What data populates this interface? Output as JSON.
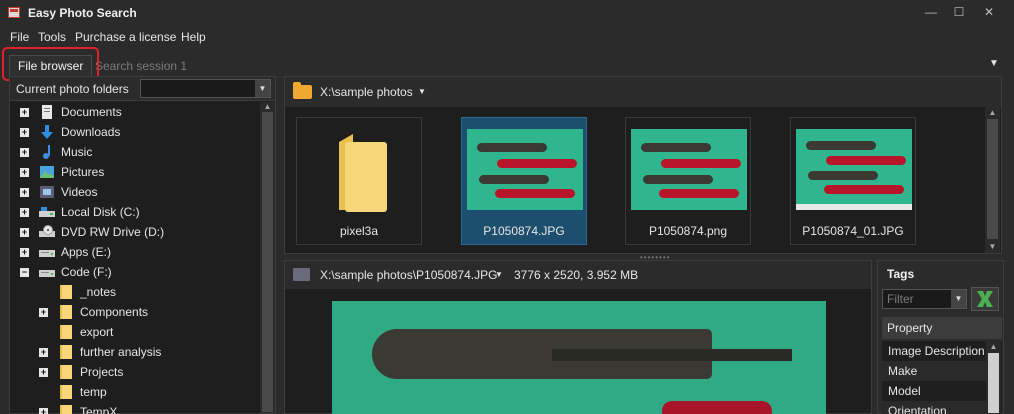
{
  "window": {
    "title": "Easy Photo Search",
    "minimize": "—",
    "maximize": "☐",
    "close": "✕"
  },
  "menu": [
    "File",
    "Tools",
    "Purchase a license",
    "Help"
  ],
  "tabs": {
    "active": "File browser",
    "inactive": "Search session 1",
    "menu_glyph": "▼"
  },
  "left_panel": {
    "header": "Current photo folders",
    "items": [
      {
        "label": "Documents",
        "icon": "documents-icon"
      },
      {
        "label": "Downloads",
        "icon": "downloads-icon"
      },
      {
        "label": "Music",
        "icon": "music-icon"
      },
      {
        "label": "Pictures",
        "icon": "pictures-icon"
      },
      {
        "label": "Videos",
        "icon": "videos-icon"
      },
      {
        "label": "Local Disk (C:)",
        "icon": "drive-icon"
      },
      {
        "label": "DVD RW Drive (D:)",
        "icon": "dvd-drive-icon"
      },
      {
        "label": "Apps (E:)",
        "icon": "drive-icon"
      },
      {
        "label": "Code (F:)",
        "icon": "drive-icon"
      },
      {
        "label": "_notes",
        "icon": "folder-icon"
      },
      {
        "label": "Components",
        "icon": "folder-icon"
      },
      {
        "label": "export",
        "icon": "folder-icon"
      },
      {
        "label": "further analysis",
        "icon": "folder-icon"
      },
      {
        "label": "Projects",
        "icon": "folder-icon"
      },
      {
        "label": "temp",
        "icon": "folder-icon"
      },
      {
        "label": "TempX",
        "icon": "folder-icon"
      }
    ]
  },
  "browser": {
    "path": "X:\\sample photos",
    "items": [
      {
        "label": "pixel3a",
        "type": "folder"
      },
      {
        "label": "P1050874.JPG",
        "type": "photo",
        "selected": true
      },
      {
        "label": "P1050874.png",
        "type": "photo"
      },
      {
        "label": "P1050874_01.JPG",
        "type": "photo"
      }
    ]
  },
  "preview": {
    "path": "X:\\sample photos\\P1050874.JPG",
    "info": "3776 x 2520, 3.952 MB"
  },
  "tags": {
    "title": "Tags",
    "filter_placeholder": "Filter",
    "property_header": "Property",
    "properties": [
      "Image Description",
      "Make",
      "Model",
      "Orientation"
    ]
  },
  "colors": {
    "accent_selected": "#1e4e6e",
    "folder": "#f0a830",
    "highlight": "#e0202a",
    "photo_bg": "#2fb68e"
  }
}
